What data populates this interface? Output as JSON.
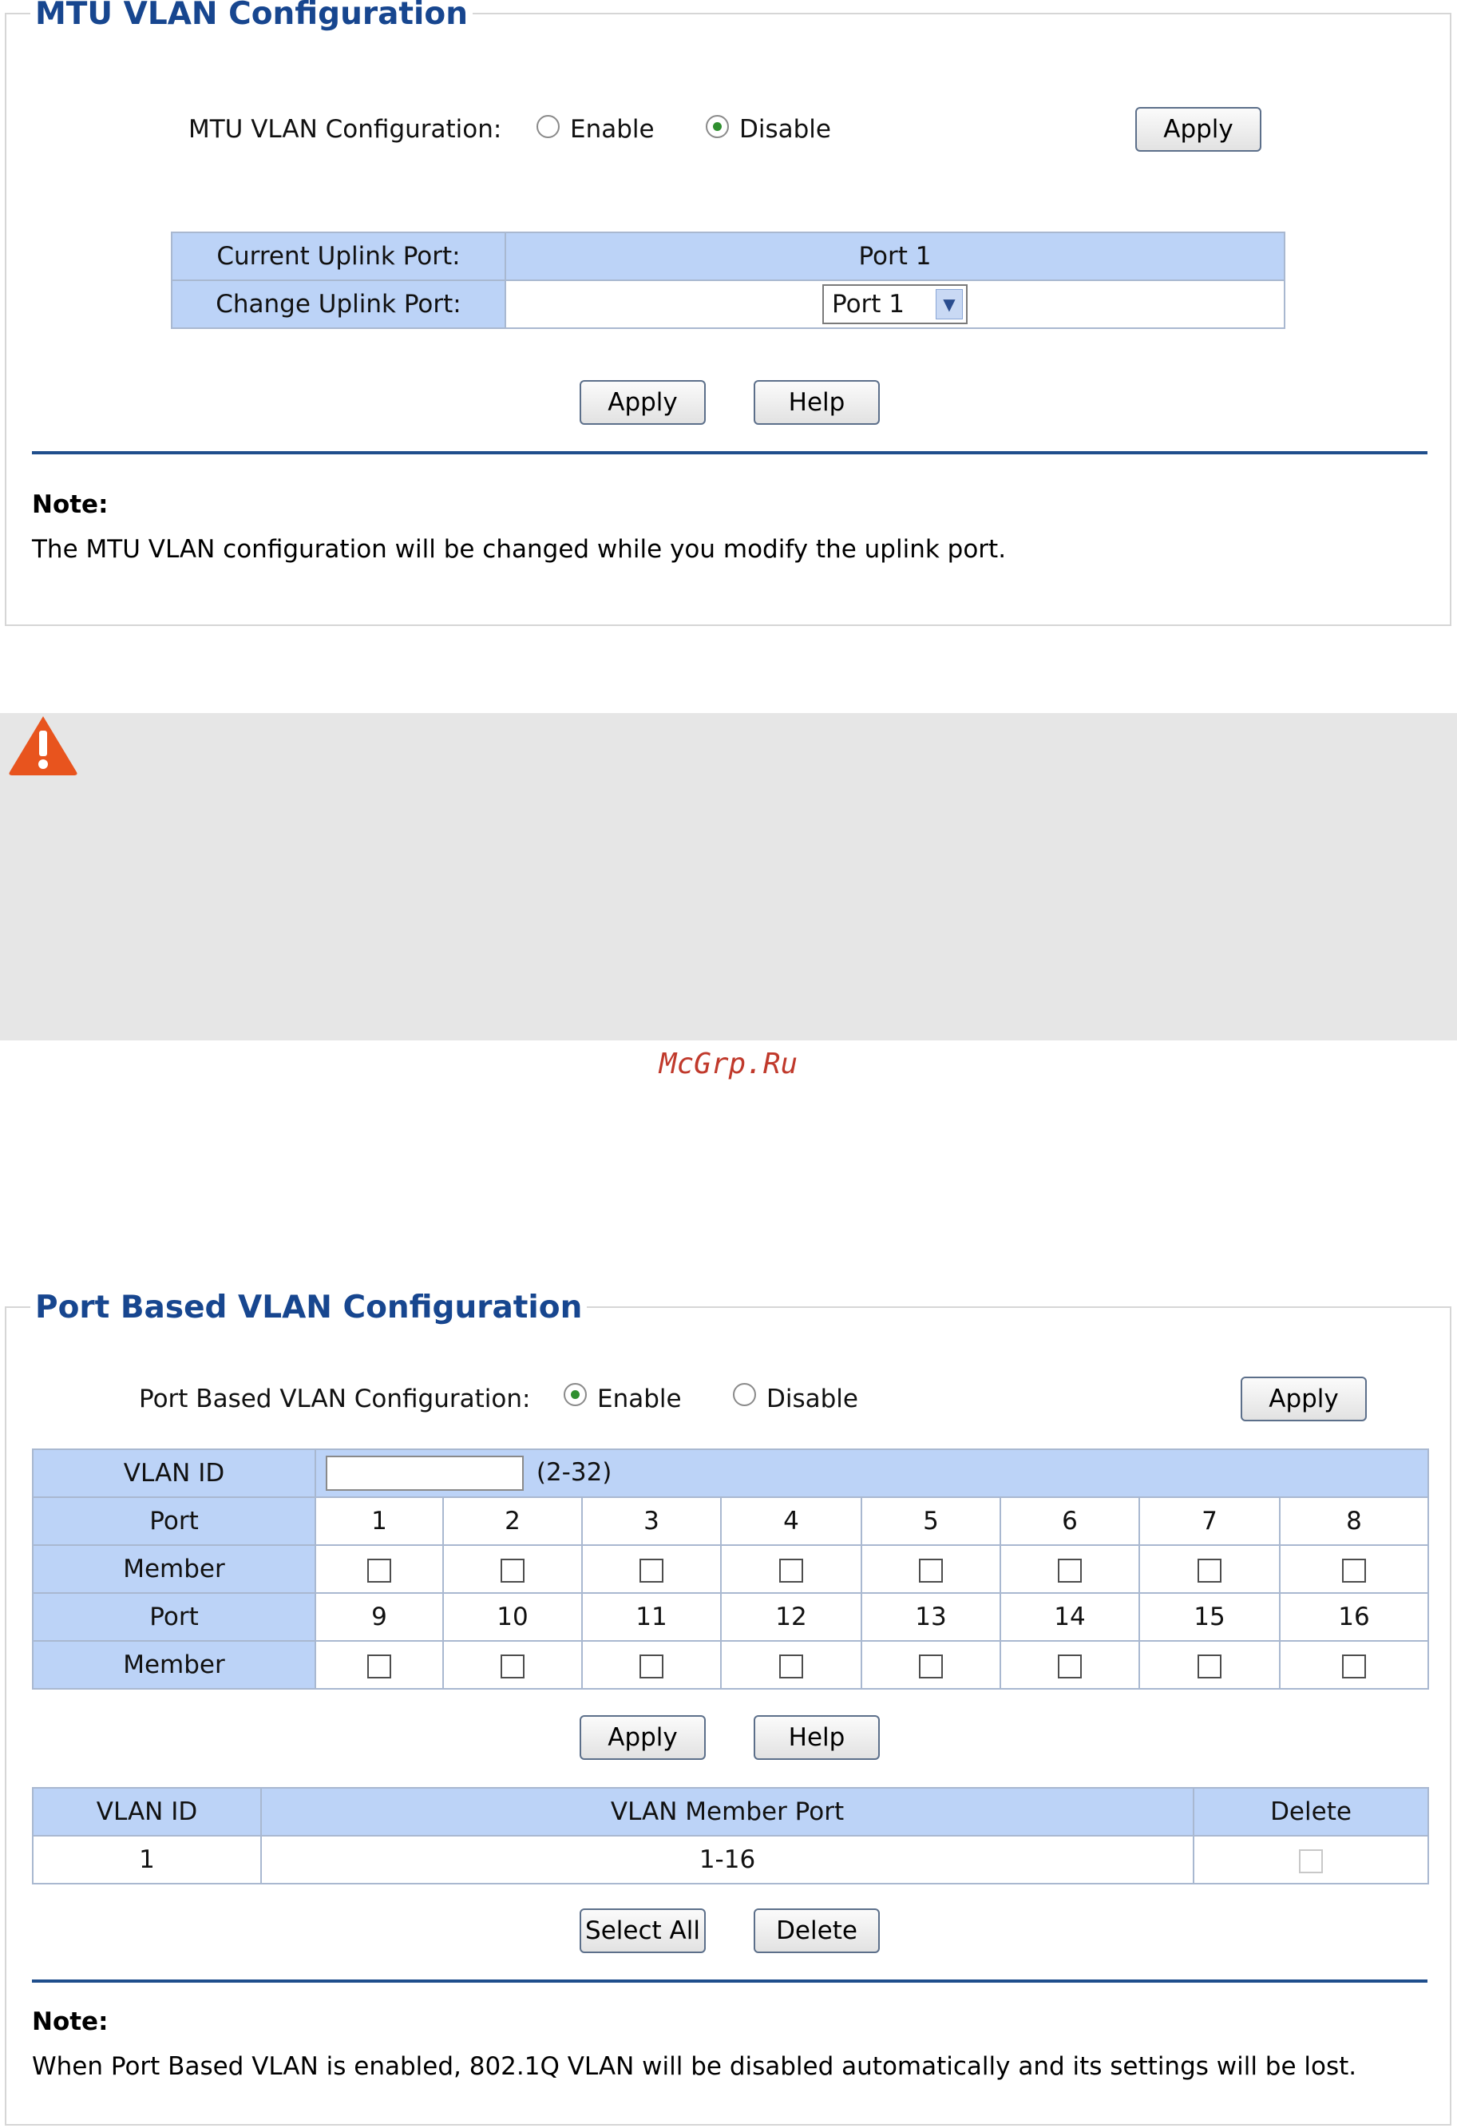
{
  "mtu": {
    "legend": "MTU VLAN Configuration",
    "config_label": "MTU VLAN Configuration:",
    "enable_label": "Enable",
    "disable_label": "Disable",
    "selected": "Disable",
    "apply_label": "Apply",
    "table": {
      "current_label": "Current Uplink Port:",
      "current_value": "Port 1",
      "change_label": "Change Uplink Port:",
      "change_value": "Port 1"
    },
    "apply2_label": "Apply",
    "help_label": "Help",
    "note_title": "Note:",
    "note_text": "The MTU VLAN configuration will be changed while you modify the uplink port."
  },
  "warning": {
    "icon": "warning-icon",
    "color": "#e8541e"
  },
  "watermark": "McGrp.Ru",
  "pb": {
    "legend": "Port Based VLAN Configuration",
    "config_label": "Port Based VLAN Configuration:",
    "enable_label": "Enable",
    "disable_label": "Disable",
    "selected": "Enable",
    "apply_label": "Apply",
    "vlan_id_label": "VLAN ID",
    "vlan_id_value": "",
    "vlan_id_range": "(2-32)",
    "port_label": "Port",
    "member_label": "Member",
    "ports_row1": [
      "1",
      "2",
      "3",
      "4",
      "5",
      "6",
      "7",
      "8"
    ],
    "ports_row2": [
      "9",
      "10",
      "11",
      "12",
      "13",
      "14",
      "15",
      "16"
    ],
    "apply2_label": "Apply",
    "help_label": "Help",
    "list_headers": {
      "id": "VLAN ID",
      "members": "VLAN Member Port",
      "delete": "Delete"
    },
    "list_rows": [
      {
        "id": "1",
        "members": "1-16"
      }
    ],
    "select_all_label": "Select All",
    "delete_label": "Delete",
    "note_title": "Note:",
    "note_text": "When Port Based VLAN is enabled, 802.1Q VLAN will be disabled automatically and its settings will be lost."
  },
  "colors": {
    "legend": "#17468f",
    "header_bg": "#bcd3f7",
    "divider": "#1f4e8c"
  }
}
